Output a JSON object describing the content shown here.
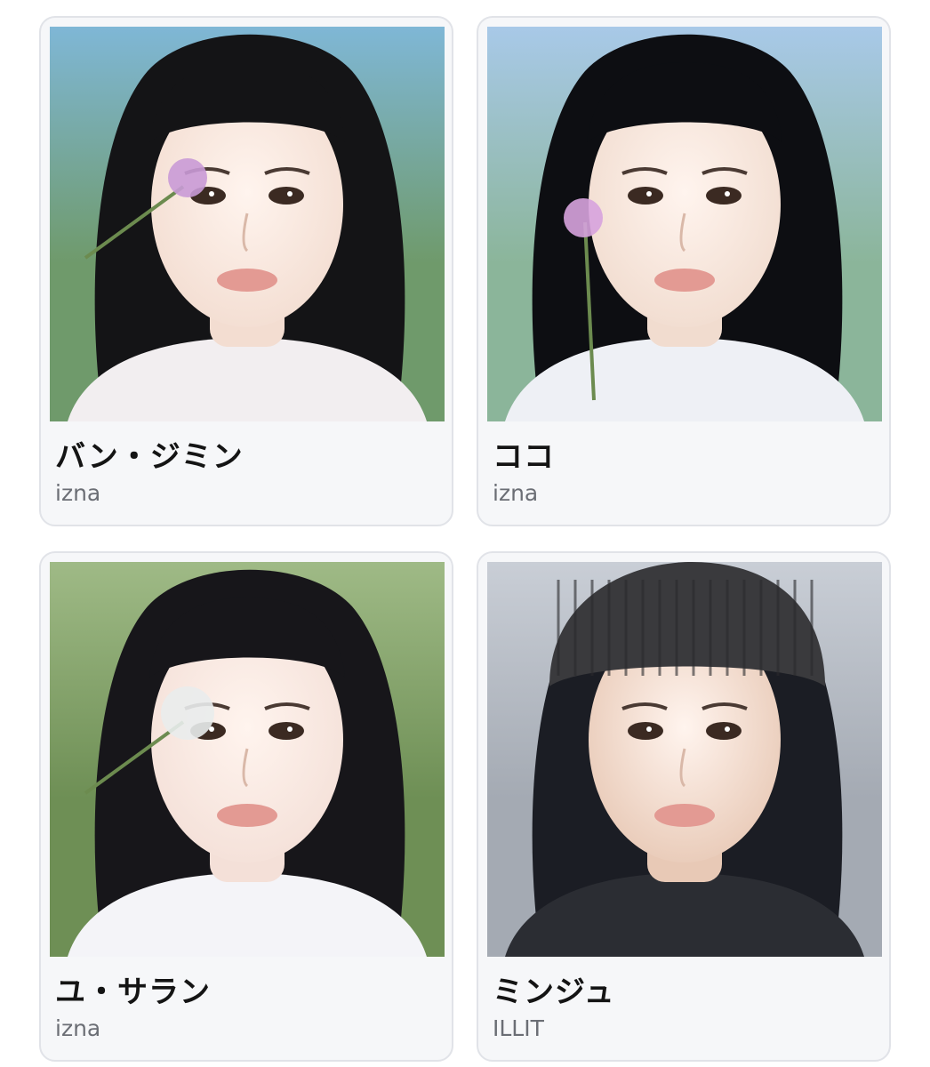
{
  "profiles": [
    {
      "name": "バン・ジミン",
      "group": "izna",
      "photo": {
        "icon": "portrait-photo",
        "background": "#6f9a6b",
        "sky": "#7fb7d6",
        "hair": "#141416",
        "skin": "#f3ddd1",
        "clothes": "#f2eef0",
        "accent": "#c99ad6"
      }
    },
    {
      "name": "ココ",
      "group": "izna",
      "photo": {
        "icon": "portrait-photo",
        "background": "#8bb59a",
        "sky": "#a8c9e8",
        "hair": "#0d0e12",
        "skin": "#f1dccf",
        "clothes": "#eef0f5",
        "accent": "#d7a3de"
      }
    },
    {
      "name": "ユ・サラン",
      "group": "izna",
      "photo": {
        "icon": "portrait-photo",
        "background": "#6e8f55",
        "sky": "#9fba86",
        "hair": "#17161a",
        "skin": "#f4e0d8",
        "clothes": "#f4f4f8",
        "accent": "#e9ecec"
      }
    },
    {
      "name": "ミンジュ",
      "group": "ILLIT",
      "photo": {
        "icon": "portrait-photo",
        "background": "#a4aab3",
        "sky": "#c9ced6",
        "hair": "#1b1d24",
        "skin": "#e8c9b6",
        "clothes": "#2b2d33",
        "accent": "#3a3a3d"
      }
    }
  ]
}
